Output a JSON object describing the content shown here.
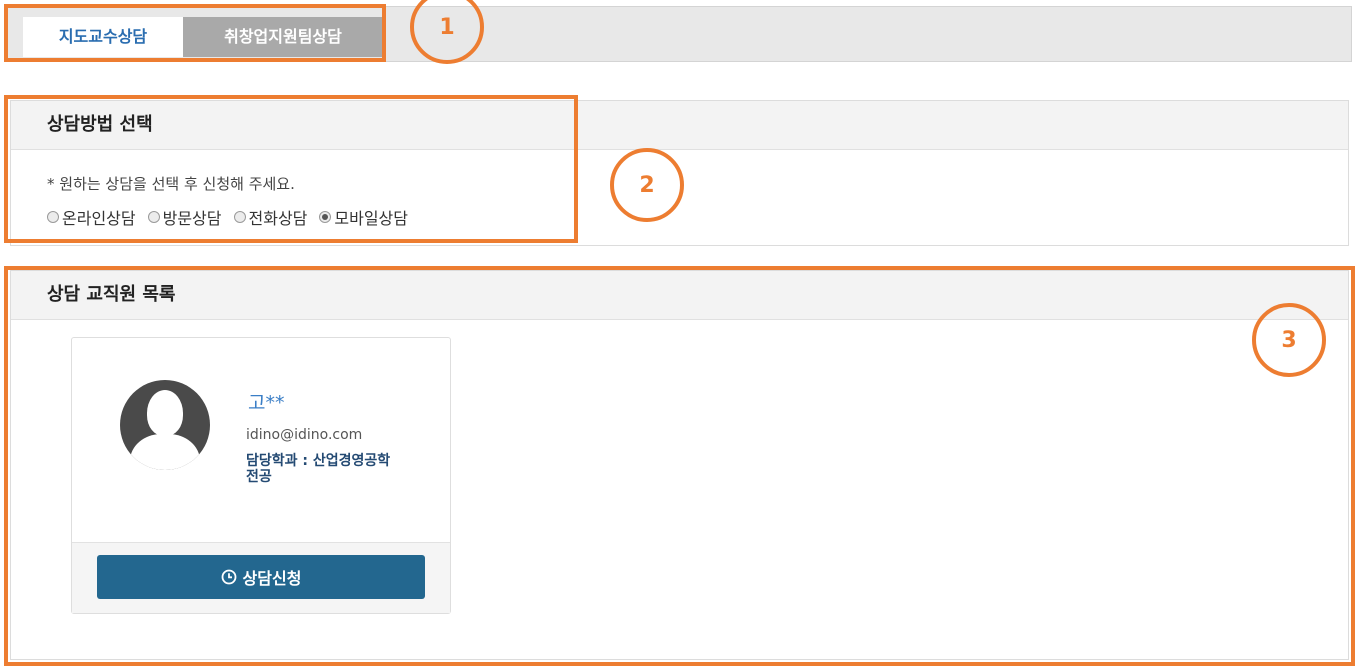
{
  "tabs": [
    {
      "label": "지도교수상담",
      "active": true
    },
    {
      "label": "취창업지원팀상담",
      "active": false
    }
  ],
  "method_panel": {
    "title": "상담방법 선택",
    "hint": "* 원하는 상담을 선택 후 신청해 주세요.",
    "options": [
      {
        "label": "온라인상담",
        "checked": false
      },
      {
        "label": "방문상담",
        "checked": false
      },
      {
        "label": "전화상담",
        "checked": false
      },
      {
        "label": "모바일상담",
        "checked": true
      }
    ]
  },
  "staff_panel": {
    "title": "상담 교직원 목록",
    "staff": {
      "name": "고**",
      "email": "idino@idino.com",
      "department": "담당학과 : 산업경영공학전공",
      "apply_label": "상담신청"
    }
  },
  "annotations": [
    "1",
    "2",
    "3"
  ],
  "colors": {
    "accent": "#ed7d31",
    "button": "#23678f",
    "tab_active_text": "#2a6db0"
  }
}
